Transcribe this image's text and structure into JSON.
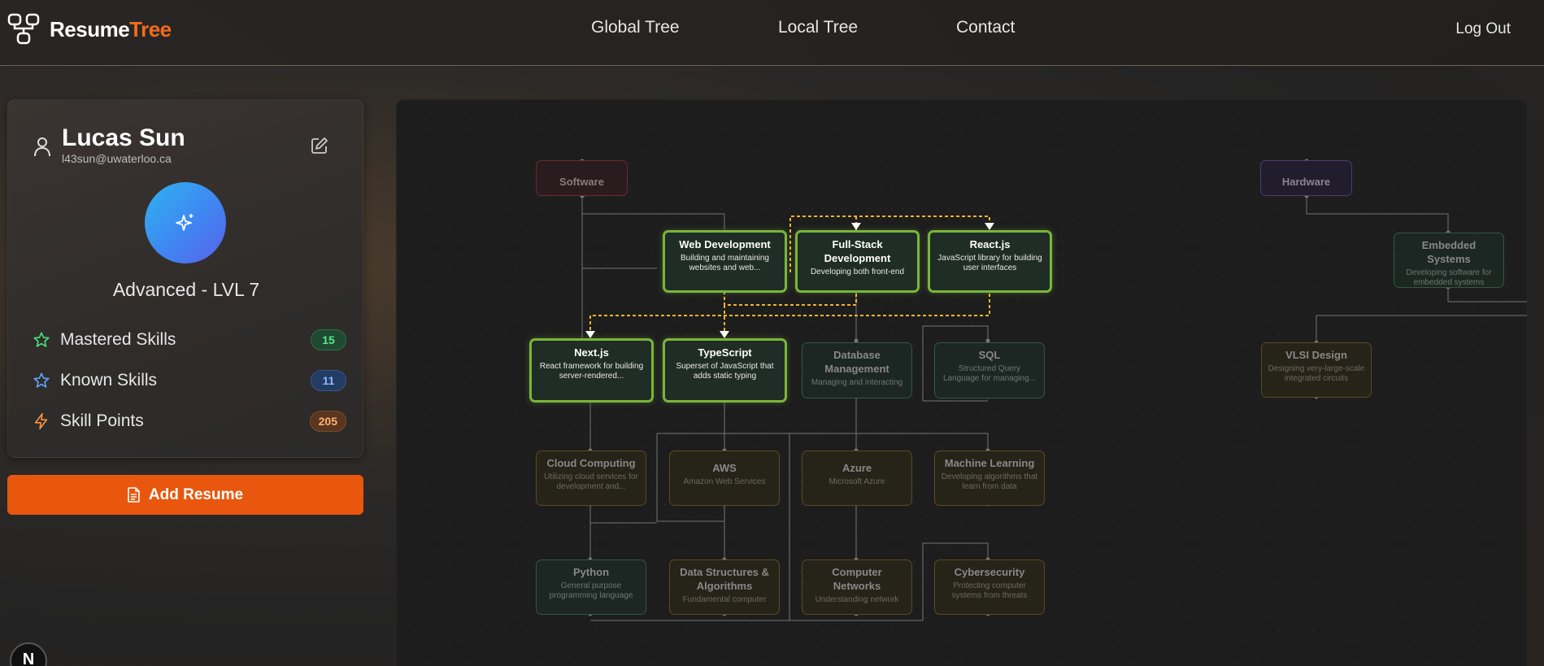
{
  "header": {
    "brand_main": "Resume",
    "brand_accent": "Tree",
    "nav": [
      "Global Tree",
      "Local Tree",
      "Contact"
    ],
    "logout": "Log Out"
  },
  "profile": {
    "name": "Lucas Sun",
    "email": "l43sun@uwaterloo.ca",
    "level": "Advanced - LVL 7",
    "stats": [
      {
        "label": "Mastered Skills",
        "value": "15",
        "icon": "star-icon",
        "color": "#4ade80"
      },
      {
        "label": "Known Skills",
        "value": "11",
        "icon": "star-icon",
        "color": "#60a5fa"
      },
      {
        "label": "Skill Points",
        "value": "205",
        "icon": "lightning-icon",
        "color": "#fb923c"
      }
    ]
  },
  "add_resume": "Add Resume",
  "next_badge": "N",
  "tree": {
    "roots": [
      {
        "title": "Software",
        "desc": ""
      },
      {
        "title": "Hardware",
        "desc": ""
      }
    ],
    "nodes": [
      {
        "title": "Web Development",
        "desc": "Building and maintaining websites and web..."
      },
      {
        "title": "Full-Stack Development",
        "desc": "Developing both front-end"
      },
      {
        "title": "React.js",
        "desc": "JavaScript library for building user interfaces"
      },
      {
        "title": "Next.js",
        "desc": "React framework for building server-rendered..."
      },
      {
        "title": "TypeScript",
        "desc": "Superset of JavaScript that adds static typing"
      },
      {
        "title": "Database Management",
        "desc": "Managing and interacting"
      },
      {
        "title": "SQL",
        "desc": "Structured Query Language for managing..."
      },
      {
        "title": "Cloud Computing",
        "desc": "Utilizing cloud services for development and..."
      },
      {
        "title": "AWS",
        "desc": "Amazon Web Services"
      },
      {
        "title": "Azure",
        "desc": "Microsoft Azure"
      },
      {
        "title": "Machine Learning",
        "desc": "Developing algorithms that learn from data"
      },
      {
        "title": "Python",
        "desc": "General purpose programming language"
      },
      {
        "title": "Data Structures & Algorithms",
        "desc": "Fundamental computer"
      },
      {
        "title": "Computer Networks",
        "desc": "Understanding network"
      },
      {
        "title": "Cybersecurity",
        "desc": "Protecting computer systems from threats"
      },
      {
        "title": "Embedded Systems",
        "desc": "Developing software for embedded systems"
      },
      {
        "title": "VLSI Design",
        "desc": "Designing very-large-scale integrated circuits"
      }
    ]
  },
  "colors": {
    "accent": "#f26b1d",
    "button": "#e8570d",
    "active_border": "#7ab53a",
    "highlight_path": "#f0b429"
  }
}
